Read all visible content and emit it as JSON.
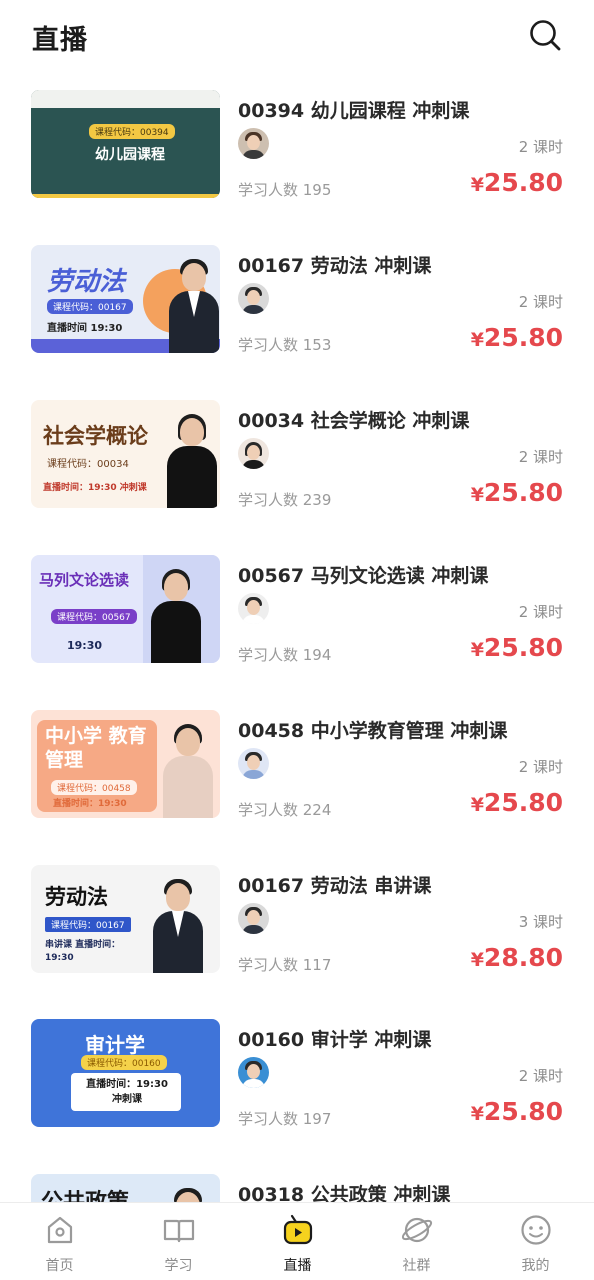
{
  "header": {
    "title": "直播",
    "search_icon": "search-icon"
  },
  "courses": [
    {
      "title": "00394 幼儿园课程 冲刺课",
      "hours": "2 课时",
      "learners": "学习人数 195",
      "currency": "¥",
      "price": "25.80",
      "thumb": {
        "title": "幼儿园课程",
        "tag": "课程代码：00394",
        "time": "",
        "bg": "#2b5452",
        "accent": "#f3c843",
        "text_color": "#ffffff"
      }
    },
    {
      "title": "00167 劳动法 冲刺课",
      "hours": "2 课时",
      "learners": "学习人数 153",
      "currency": "¥",
      "price": "25.80",
      "thumb": {
        "title": "劳动法",
        "tag": "课程代码：00167",
        "time": "直播时间 19:30",
        "bg": "#e7ecf7",
        "accent": "#5b62d8",
        "text_color": "#4a5fd6"
      }
    },
    {
      "title": "00034 社会学概论 冲刺课",
      "hours": "2 课时",
      "learners": "学习人数 239",
      "currency": "¥",
      "price": "25.80",
      "thumb": {
        "title": "社会学概论",
        "tag": "课程代码：00034",
        "time": "直播时间：19:30 冲刺课",
        "bg": "#fbf3ea",
        "accent": "#c47a3a",
        "text_color": "#6b3d1b"
      }
    },
    {
      "title": "00567 马列文论选读 冲刺课",
      "hours": "2 课时",
      "learners": "学习人数 194",
      "currency": "¥",
      "price": "25.80",
      "thumb": {
        "title": "马列文论选读",
        "tag": "课程代码：00567",
        "time": "19:30",
        "bg": "#e3e7fb",
        "accent": "#7a3fc8",
        "text_color": "#6a2fb8"
      }
    },
    {
      "title": "00458 中小学教育管理 冲刺课",
      "hours": "2 课时",
      "learners": "学习人数 224",
      "currency": "¥",
      "price": "25.80",
      "thumb": {
        "title": "中小学 教育管理",
        "tag": "课程代码：00458",
        "time": "直播时间：19:30",
        "bg": "#fde2d6",
        "accent": "#f08a5d",
        "text_color": "#ffffff"
      }
    },
    {
      "title": "00167 劳动法 串讲课",
      "hours": "3 课时",
      "learners": "学习人数 117",
      "currency": "¥",
      "price": "28.80",
      "thumb": {
        "title": "劳动法",
        "tag": "课程代码：00167",
        "time": "串讲课 直播时间：19:30",
        "bg": "#f4f4f4",
        "accent": "#2f56c9",
        "text_color": "#111111"
      }
    },
    {
      "title": "00160 审计学 冲刺课",
      "hours": "2 课时",
      "learners": "学习人数 197",
      "currency": "¥",
      "price": "25.80",
      "thumb": {
        "title": "审计学",
        "tag": "课程代码：00160",
        "time": "直播时间：19:30 冲刺课",
        "bg": "#3f74d9",
        "accent": "#f5d24a",
        "text_color": "#ffffff"
      }
    },
    {
      "title": "00318 公共政策 冲刺课",
      "hours": "",
      "learners": "",
      "currency": "",
      "price": "",
      "thumb": {
        "title": "公共政策",
        "tag": "",
        "time": "",
        "bg": "#dde9f7",
        "accent": "#2f56c9",
        "text_color": "#1a1a1a"
      }
    }
  ],
  "tabbar": [
    {
      "label": "首页",
      "icon": "home-icon",
      "active": false
    },
    {
      "label": "学习",
      "icon": "book-icon",
      "active": false
    },
    {
      "label": "直播",
      "icon": "live-tv-icon",
      "active": true
    },
    {
      "label": "社群",
      "icon": "planet-icon",
      "active": false
    },
    {
      "label": "我的",
      "icon": "smiley-face-icon",
      "active": false
    }
  ],
  "colors": {
    "price": "#e5484d",
    "accent_yellow": "#f6d21e",
    "text_muted": "#8d8d8d"
  }
}
